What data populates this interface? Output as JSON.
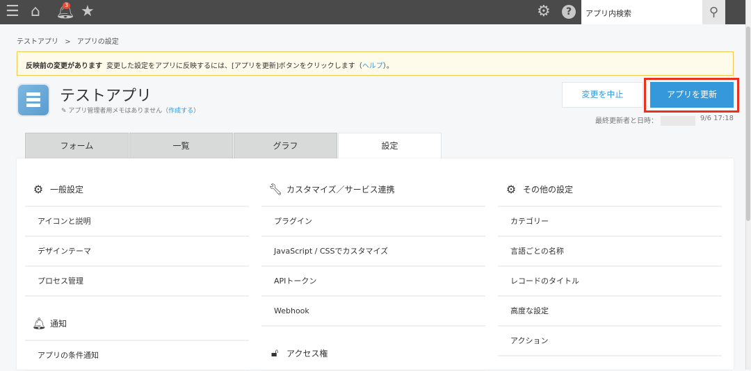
{
  "topbar": {
    "badge_count": "3",
    "search_placeholder": "アプリ内検索"
  },
  "breadcrumb": {
    "app": "テストアプリ",
    "sep": ">",
    "current": "アプリの設定"
  },
  "notice": {
    "title": "反映前の変更があります",
    "text": "変更した設定をアプリに反映するには、[アプリを更新]ボタンをクリックします（",
    "link": "ヘルプ",
    "end": "）。"
  },
  "app": {
    "title": "テストアプリ",
    "memo": "アプリ管理者用メモはありません（",
    "memo_link": "作成する",
    "memo_end": "）"
  },
  "buttons": {
    "cancel": "変更を中止",
    "update": "アプリを更新"
  },
  "last_updated": {
    "label": "最終更新者と日時：",
    "datetime": "9/6 17:18"
  },
  "tabs": [
    "フォーム",
    "一覧",
    "グラフ",
    "設定"
  ],
  "columns": [
    [
      {
        "heading": "一般設定",
        "icon": "gear-icon",
        "items": [
          "アイコンと説明",
          "デザインテーマ",
          "プロセス管理"
        ]
      },
      {
        "heading": "通知",
        "icon": "bell-icon",
        "items": [
          "アプリの条件通知"
        ]
      }
    ],
    [
      {
        "heading": "カスタマイズ／サービス連携",
        "icon": "wrench-icon",
        "items": [
          "プラグイン",
          "JavaScript / CSSでカスタマイズ",
          "APIトークン",
          "Webhook"
        ]
      },
      {
        "heading": "アクセス権",
        "icon": "lock-icon",
        "items": []
      }
    ],
    [
      {
        "heading": "その他の設定",
        "icon": "gears-icon",
        "items": [
          "カテゴリー",
          "言語ごとの名称",
          "レコードのタイトル",
          "高度な設定",
          "アクション"
        ]
      }
    ]
  ]
}
